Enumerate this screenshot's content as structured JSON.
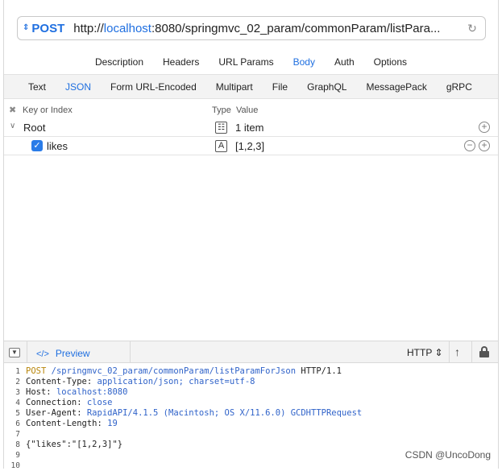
{
  "request": {
    "method": "POST",
    "url_prefix": "http://",
    "url_host": "localhost",
    "url_rest": ":8080/springmvc_02_param/commonParam/listPara..."
  },
  "main_tabs": [
    "Description",
    "Headers",
    "URL Params",
    "Body",
    "Auth",
    "Options"
  ],
  "active_main_tab": "Body",
  "body_tabs": [
    "Text",
    "JSON",
    "Form URL-Encoded",
    "Multipart",
    "File",
    "GraphQL",
    "MessagePack",
    "gRPC"
  ],
  "active_body_tab": "JSON",
  "tree": {
    "header_key": "Key or Index",
    "header_type": "Type",
    "header_value": "Value",
    "root": {
      "label": "Root",
      "value": "1 item",
      "type_icon": "list-icon"
    },
    "items": [
      {
        "key": "likes",
        "type_icon": "A",
        "value": "[1,2,3]",
        "checked": true
      }
    ]
  },
  "preview_bar": {
    "code_icon": "</>",
    "label": "Preview",
    "format": "HTTP ⇕"
  },
  "code_lines": [
    {
      "n": "1",
      "parts": [
        [
          "kw",
          "POST"
        ],
        [
          "blue",
          " /springmvc_02_param/commonParam/listParamForJson"
        ],
        [
          "",
          " HTTP/1.1"
        ]
      ]
    },
    {
      "n": "2",
      "parts": [
        [
          "",
          "Content-Type: "
        ],
        [
          "blue",
          "application/json; charset=utf-8"
        ]
      ]
    },
    {
      "n": "3",
      "parts": [
        [
          "",
          "Host: "
        ],
        [
          "blue",
          "localhost:8080"
        ]
      ]
    },
    {
      "n": "4",
      "parts": [
        [
          "",
          "Connection: "
        ],
        [
          "blue",
          "close"
        ]
      ]
    },
    {
      "n": "5",
      "parts": [
        [
          "",
          "User-Agent: "
        ],
        [
          "blue",
          "RapidAPI/4.1.5 (Macintosh; OS X/11.6.0) GCDHTTPRequest"
        ]
      ]
    },
    {
      "n": "6",
      "parts": [
        [
          "",
          "Content-Length: "
        ],
        [
          "blue",
          "19"
        ]
      ]
    },
    {
      "n": "7",
      "parts": []
    },
    {
      "n": "8",
      "parts": [
        [
          "",
          "{\"likes\":\"[1,2,3]\"}"
        ]
      ]
    },
    {
      "n": "9",
      "parts": []
    },
    {
      "n": "10",
      "parts": []
    }
  ],
  "watermark": "CSDN @UncoDong",
  "colors": {
    "accent": "#1f6fe0",
    "keyword": "#b8860b",
    "code_value": "#3063c9",
    "checkbox": "#2a7ce8"
  }
}
